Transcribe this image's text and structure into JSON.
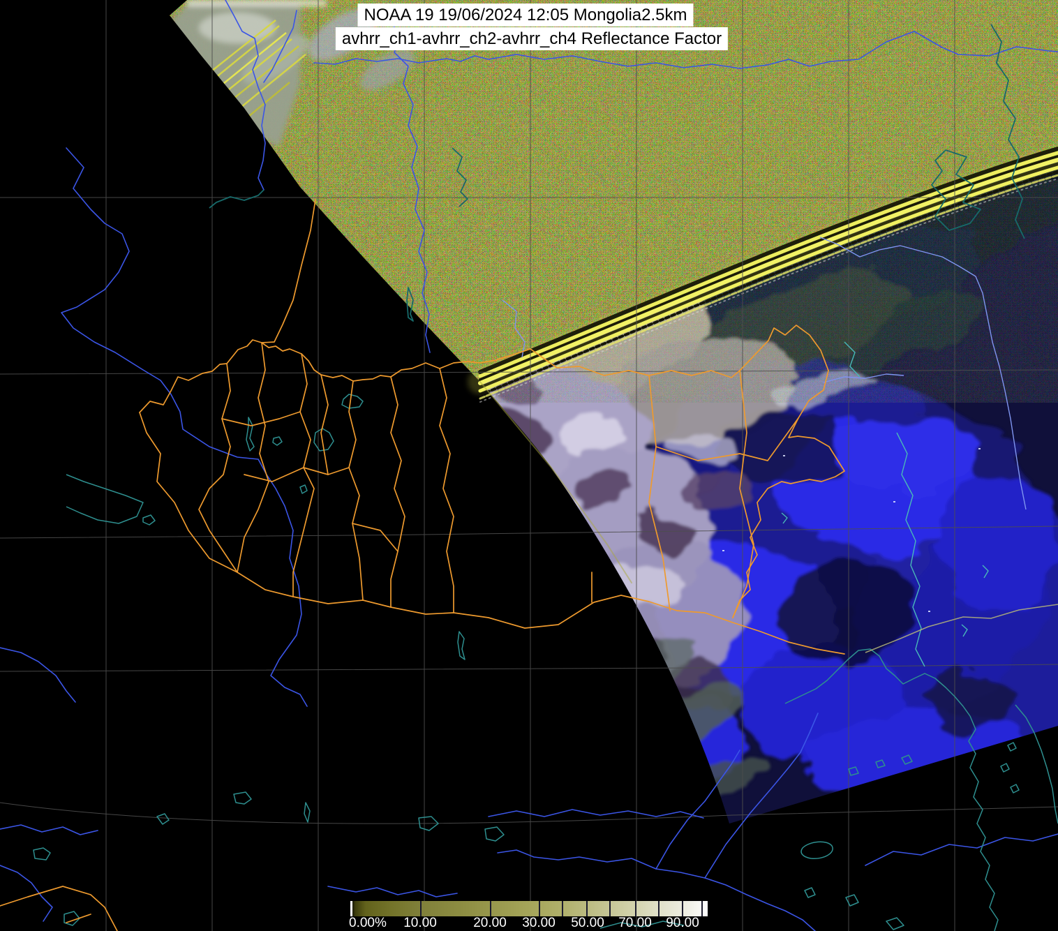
{
  "header": {
    "line1": "NOAA 19 19/06/2024 12:05 Mongolia2.5km",
    "line2": "avhrr_ch1-avhrr_ch2-avhrr_ch4 Reflectance Factor",
    "satellite": "NOAA 19",
    "date": "19/06/2024",
    "time": "12:05",
    "region": "Mongolia",
    "resolution": "2.5km",
    "channel_combo": "avhrr_ch1-avhrr_ch2-avhrr_ch4",
    "quantity": "Reflectance Factor"
  },
  "colorbar": {
    "unit": "%",
    "ticks": [
      {
        "label": "0.00%",
        "value": 0
      },
      {
        "label": "10.00",
        "value": 10
      },
      {
        "label": "20.00",
        "value": 20
      },
      {
        "label": "30.00",
        "value": 30
      },
      {
        "label": "50.00",
        "value": 50
      },
      {
        "label": "70.00",
        "value": 70
      },
      {
        "label": "90.00",
        "value": 90
      }
    ],
    "gradient_start": "#3c3c0c",
    "gradient_end": "#ffffff"
  },
  "map": {
    "layers": [
      {
        "name": "graticule",
        "color": "#4e4e4e"
      },
      {
        "name": "province-borders",
        "color": "#ee9a2e"
      },
      {
        "name": "rivers",
        "color": "#3b55e6"
      },
      {
        "name": "lakes-coastlines",
        "color": "#2e8f8f"
      },
      {
        "name": "rivers-on-imagery",
        "color": "#7f95f0"
      },
      {
        "name": "border-on-imagery-faint",
        "color": "#b8b878"
      }
    ],
    "swath": {
      "noise_base": "#b3af68",
      "scanline_artifact": "#f2f266",
      "imagery_base": "#10103a",
      "cloud_lavender": "#a49dc2",
      "cloud_bright_blue": "#2a2ae6",
      "start_edge_gray": "#98a08e"
    }
  }
}
